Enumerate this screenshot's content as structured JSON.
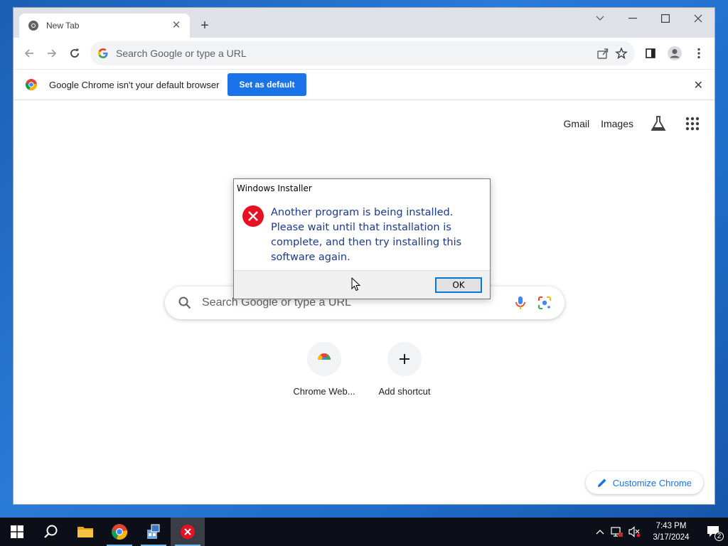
{
  "browser": {
    "tab": {
      "title": "New Tab"
    },
    "omnibox": {
      "placeholder": "Search Google or type a URL"
    },
    "infobar": {
      "message": "Google Chrome isn't your default browser",
      "button_label": "Set as default"
    }
  },
  "ntp": {
    "links": [
      "Gmail",
      "Images"
    ],
    "search_placeholder": "Search Google or type a URL",
    "shortcuts": [
      {
        "label": "Chrome Web..."
      },
      {
        "label": "Add shortcut"
      }
    ],
    "customize_label": "Customize Chrome"
  },
  "dialog": {
    "title": "Windows Installer",
    "message": "Another program is being installed. Please wait until that installation is complete, and then try installing this software again.",
    "ok_label": "OK"
  },
  "taskbar": {
    "time": "7:43 PM",
    "date": "3/17/2024",
    "notification_count": "2"
  },
  "colors": {
    "accent": "#1a73e8",
    "error": "#e81123",
    "taskbar": "#0c0f17"
  }
}
